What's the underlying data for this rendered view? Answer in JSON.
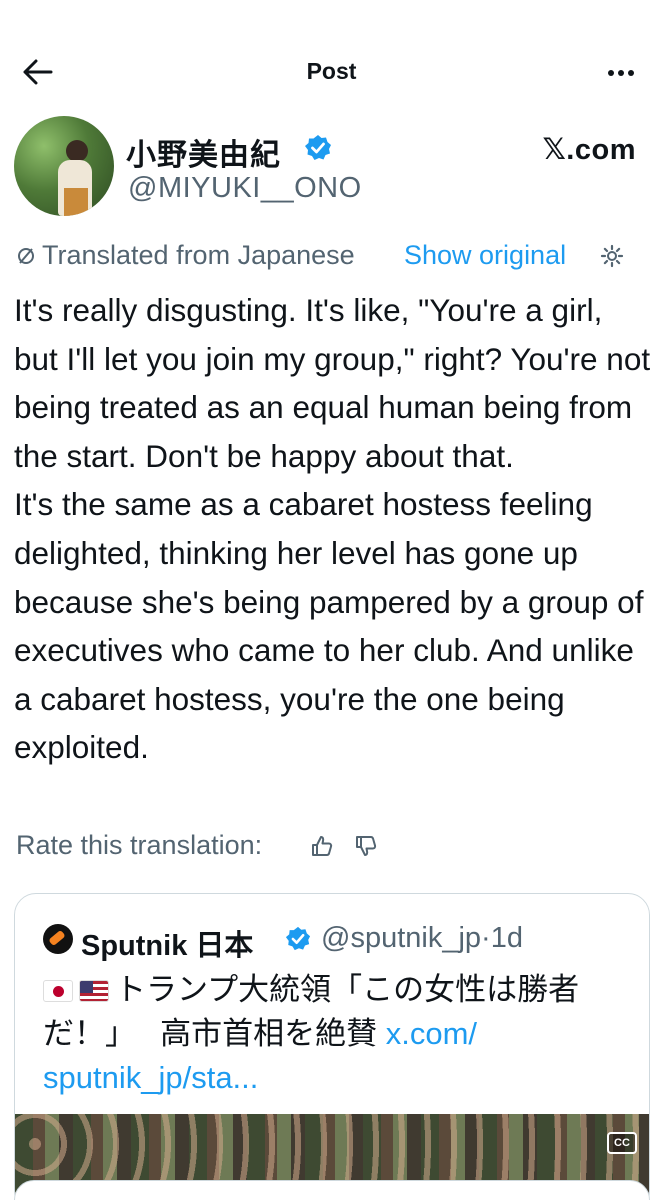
{
  "nav": {
    "title": "Post"
  },
  "author": {
    "display_name": "小野美由紀",
    "handle": "@MIYUKI__ONO",
    "source": "𝕏.com"
  },
  "translation": {
    "label": "Translated from Japanese",
    "show_original": "Show original",
    "rate_label": "Rate this translation:"
  },
  "post": {
    "text": "It's really disgusting. It's like, \"You're a girl, but I'll let you join my group,\" right? You're not being treated as an equal human being from the start. Don't be happy about that.\nIt's the same as a cabaret hostess feeling delighted, thinking her level has gone up because she's being pampered by a group of executives who came to her club. And unlike a cabaret hostess, you're the one being exploited."
  },
  "quote": {
    "name": "Sputnik 日本",
    "handle": "@sputnik_jp",
    "time": "·1d",
    "text": "トランプ大統領「この女性は勝者だ！」　 高市首相を絶賛 ",
    "link": "x.com/\nsputnik_jp/sta...",
    "media_badge": "CC"
  },
  "icons": {
    "back": "arrow-left-icon",
    "more": "more-horizontal-icon",
    "verified": "verified-badge-icon",
    "translate": "translate-icon",
    "settings": "gear-icon",
    "thumb_up": "thumbs-up-icon",
    "thumb_down": "thumbs-down-icon"
  },
  "colors": {
    "accent": "#1d9bf0",
    "secondary_text": "#536471",
    "text": "#0f1419"
  }
}
